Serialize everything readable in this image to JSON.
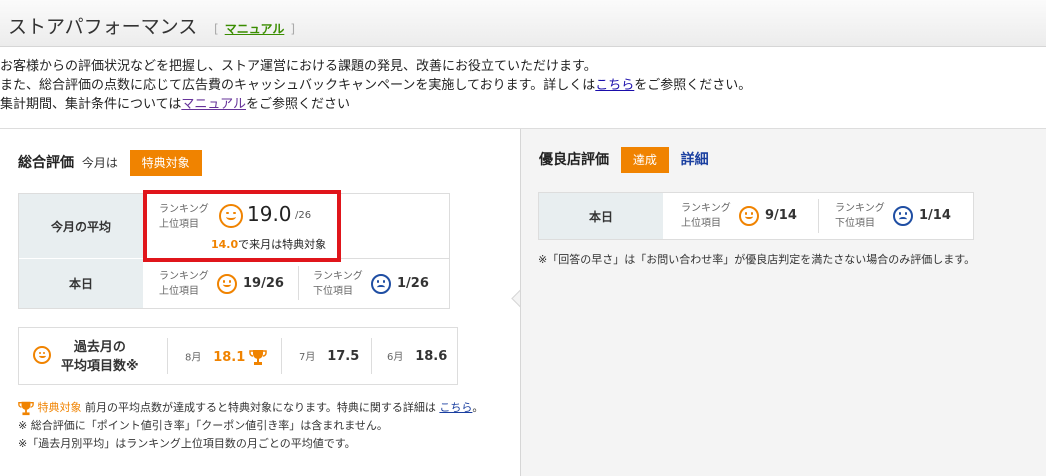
{
  "header": {
    "title": "ストアパフォーマンス",
    "manual_link": "マニュアル"
  },
  "intro": {
    "line1": "お客様からの評価状況などを把握し、ストア運営における課題の発見、改善にお役立ていただけます。",
    "line2_pre": "また、総合評価の点数に応じて広告費のキャッシュバックキャンペーンを実施しております。詳しくは",
    "line2_link": "こちら",
    "line2_post": "をご参照ください。",
    "line3_pre": "集計期間、集計条件については",
    "line3_link": "マニュアル",
    "line3_post": "をご参照ください"
  },
  "overall": {
    "heading": "総合評価",
    "this_month_label": "今月は",
    "badge": "特典対象",
    "monthly_avg_label": "今月の平均",
    "ranking_label": "ランキング",
    "upper_label": "上位項目",
    "lower_label": "下位項目",
    "avg_value": "19.0",
    "avg_total": "/26",
    "next_threshold": "14.0",
    "next_text": "で来月は特典対象",
    "today_label": "本日",
    "today_upper": "19/26",
    "today_lower": "1/26"
  },
  "past": {
    "label_line1": "過去月の",
    "label_line2": "平均項目数※",
    "months": [
      {
        "month": "8月",
        "value": "18.1",
        "highlight": true
      },
      {
        "month": "7月",
        "value": "17.5",
        "highlight": false
      },
      {
        "month": "6月",
        "value": "18.6",
        "highlight": false
      }
    ]
  },
  "notes": {
    "n1_badge": "特典対象",
    "n1_text": "前月の平均点数が達成すると特典対象になります。特典に関する詳細は",
    "n1_link": "こちら",
    "n1_end": "。",
    "n2": "※ 総合評価に「ポイント値引き率」「クーポン値引き率」は含まれません。",
    "n3": "※「過去月別平均」はランキング上位項目数の月ごとの平均値です。"
  },
  "excellent": {
    "heading": "優良店評価",
    "badge": "達成",
    "detail_link": "詳細",
    "today_label": "本日",
    "ranking_label": "ランキング",
    "upper_label": "上位項目",
    "lower_label": "下位項目",
    "upper_value": "9/14",
    "lower_value": "1/14",
    "note": "※「回答の早さ」は「お問い合わせ率」が優良店判定を満たさない場合のみ評価します。"
  },
  "colors": {
    "accent": "#f08300",
    "highlight_border": "#e0151b",
    "sad_blue": "#1f4ea3"
  }
}
